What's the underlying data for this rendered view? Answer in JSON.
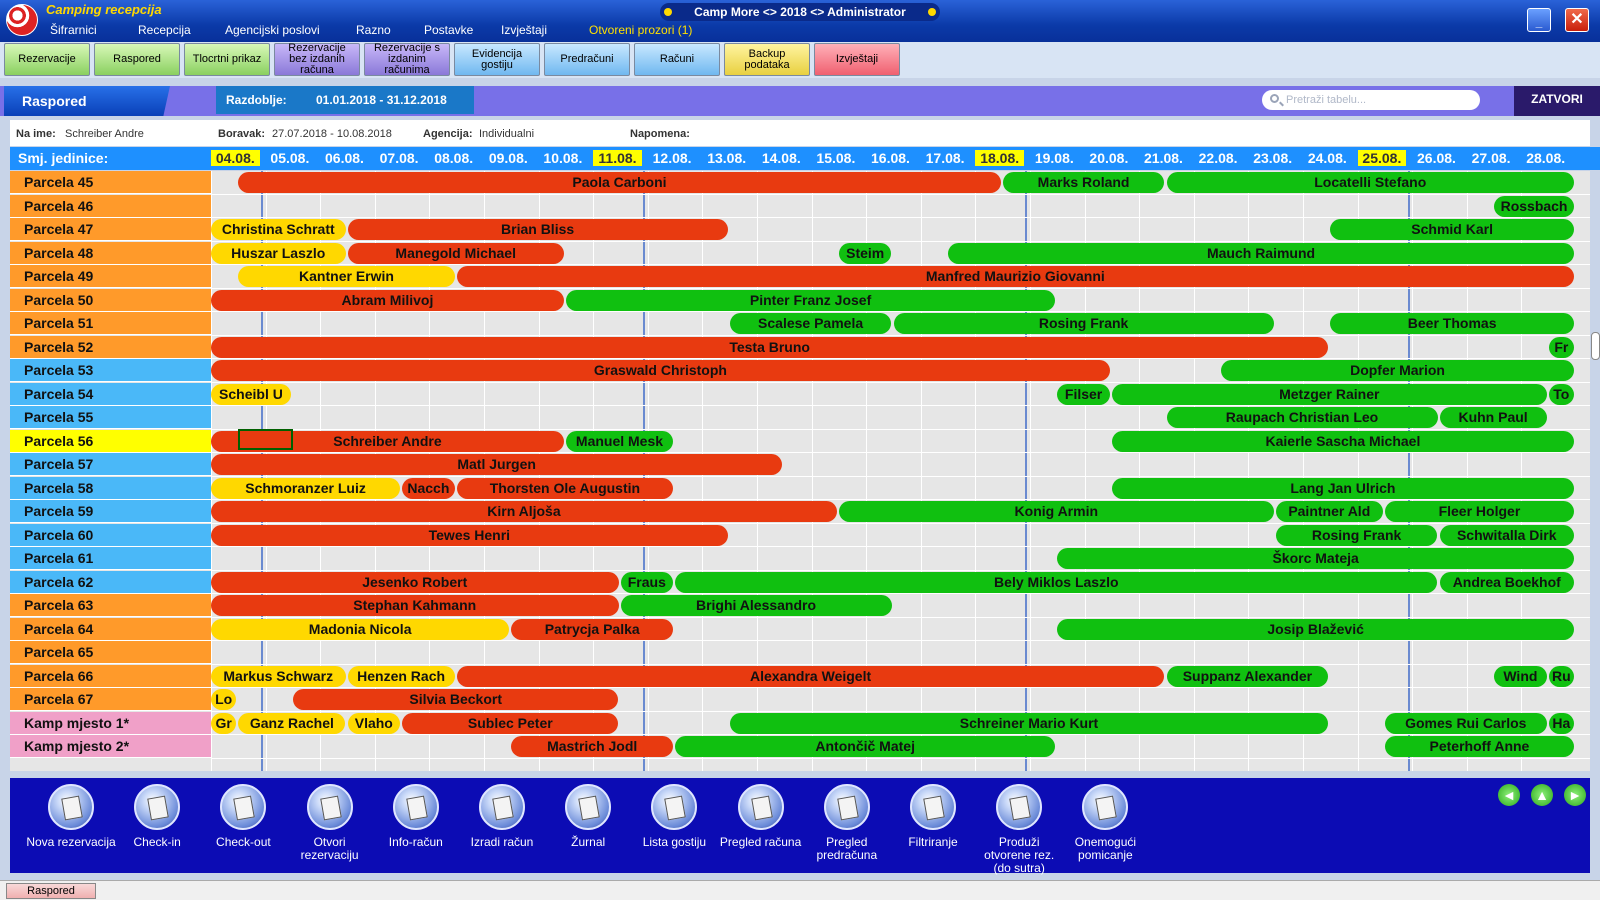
{
  "app": {
    "title": "Camping recepcija",
    "window_caption": "Camp More <> 2018 <> Administrator",
    "menu": [
      "Šifrarnici",
      "Recepcija",
      "Agencijski poslovi",
      "Razno",
      "Postavke",
      "Izvještaji",
      "Otvoreni prozori (1)"
    ],
    "minimize_label": "_",
    "close_label": "✕"
  },
  "toolbar": [
    {
      "label": "Rezervacije",
      "color": "green"
    },
    {
      "label": "Raspored",
      "color": "green"
    },
    {
      "label": "Tlocrtni prikaz",
      "color": "green"
    },
    {
      "label": "Rezervacije bez izdanih računa",
      "color": "purple"
    },
    {
      "label": "Rezervacije s izdanim računima",
      "color": "purple"
    },
    {
      "label": "Evidencija gostiju",
      "color": "blue"
    },
    {
      "label": "Predračuni",
      "color": "blue"
    },
    {
      "label": "Računi",
      "color": "blue"
    },
    {
      "label": "Backup podataka",
      "color": "yellow"
    },
    {
      "label": "Izvještaji",
      "color": "red"
    }
  ],
  "view": {
    "title": "Raspored",
    "period_label": "Razdoblje:",
    "period_value": "01.01.2018 - 31.12.2018",
    "search_placeholder": "Pretraži tabelu...",
    "close_label": "ZATVORI"
  },
  "guest_info": {
    "name_label": "Na ime:",
    "name_value": "Schreiber Andre",
    "stay_label": "Boravak:",
    "stay_value": "27.07.2018 - 10.08.2018",
    "agency_label": "Agencija:",
    "agency_value": "Individualni",
    "note_label": "Napomena:"
  },
  "schedule": {
    "units_label": "Smj. jedinice:",
    "dates": [
      "04.08.",
      "05.08.",
      "06.08.",
      "07.08.",
      "08.08.",
      "09.08.",
      "10.08.",
      "11.08.",
      "12.08.",
      "13.08.",
      "14.08.",
      "15.08.",
      "16.08.",
      "17.08.",
      "18.08.",
      "19.08.",
      "20.08.",
      "21.08.",
      "22.08.",
      "23.08.",
      "24.08.",
      "25.08.",
      "26.08.",
      "27.08.",
      "28.08."
    ],
    "highlighted_dates": [
      "04.08.",
      "11.08.",
      "18.08.",
      "25.08."
    ],
    "rows": [
      {
        "label": "Parcela 45",
        "color": "orange",
        "bars": [
          {
            "name": "Paola Carboni",
            "c": "red",
            "s": 0.5,
            "e": 14.5
          },
          {
            "name": "Marks Roland",
            "c": "green",
            "s": 14.5,
            "e": 17.5
          },
          {
            "name": "Locatelli Stefano",
            "c": "green",
            "s": 17.5,
            "e": 25
          }
        ]
      },
      {
        "label": "Parcela 46",
        "color": "orange",
        "bars": [
          {
            "name": "Rossbach",
            "c": "green",
            "s": 23.5,
            "e": 25
          }
        ]
      },
      {
        "label": "Parcela 47",
        "color": "orange",
        "bars": [
          {
            "name": "Christina Schratt",
            "c": "yellow",
            "s": 0,
            "e": 2.5
          },
          {
            "name": "Brian Bliss",
            "c": "red",
            "s": 2.5,
            "e": 9.5
          },
          {
            "name": "Schmid Karl",
            "c": "green",
            "s": 20.5,
            "e": 25
          }
        ]
      },
      {
        "label": "Parcela 48",
        "color": "orange",
        "bars": [
          {
            "name": "Huszar Laszlo",
            "c": "yellow",
            "s": 0,
            "e": 2.5
          },
          {
            "name": "Manegold Michael",
            "c": "red",
            "s": 2.5,
            "e": 6.5
          },
          {
            "name": "Steim",
            "c": "green",
            "s": 11.5,
            "e": 12.5
          },
          {
            "name": "Mauch Raimund",
            "c": "green",
            "s": 13.5,
            "e": 25
          }
        ]
      },
      {
        "label": "Parcela 49",
        "color": "orange",
        "bars": [
          {
            "name": "Kantner Erwin",
            "c": "yellow",
            "s": 0.5,
            "e": 4.5
          },
          {
            "name": "Manfred Maurizio Giovanni",
            "c": "red",
            "s": 4.5,
            "e": 25
          }
        ]
      },
      {
        "label": "Parcela 50",
        "color": "orange",
        "bars": [
          {
            "name": "Abram Milivoj",
            "c": "red",
            "s": 0,
            "e": 6.5
          },
          {
            "name": "Pinter Franz Josef",
            "c": "green",
            "s": 6.5,
            "e": 15.5
          }
        ]
      },
      {
        "label": "Parcela 51",
        "color": "orange",
        "bars": [
          {
            "name": "Scalese Pamela",
            "c": "green",
            "s": 9.5,
            "e": 12.5
          },
          {
            "name": "Rosing Frank",
            "c": "green",
            "s": 12.5,
            "e": 19.5
          },
          {
            "name": "Beer Thomas",
            "c": "green",
            "s": 20.5,
            "e": 25
          }
        ]
      },
      {
        "label": "Parcela 52",
        "color": "orange",
        "bars": [
          {
            "name": "Testa Bruno",
            "c": "red",
            "s": 0,
            "e": 20.5
          },
          {
            "name": "Fr",
            "c": "green",
            "s": 24.5,
            "e": 25
          }
        ]
      },
      {
        "label": "Parcela 53",
        "color": "blue",
        "bars": [
          {
            "name": "Graswald Christoph",
            "c": "red",
            "s": 0,
            "e": 16.5
          },
          {
            "name": "Dopfer Marion",
            "c": "green",
            "s": 18.5,
            "e": 25
          }
        ]
      },
      {
        "label": "Parcela 54",
        "color": "blue",
        "bars": [
          {
            "name": "Scheibl U",
            "c": "yellow",
            "s": 0,
            "e": 1.5
          },
          {
            "name": "Filser",
            "c": "green",
            "s": 15.5,
            "e": 16.5
          },
          {
            "name": "Metzger Rainer",
            "c": "green",
            "s": 16.5,
            "e": 24.5
          },
          {
            "name": "To",
            "c": "green",
            "s": 24.5,
            "e": 25
          }
        ]
      },
      {
        "label": "Parcela 55",
        "color": "blue",
        "bars": [
          {
            "name": "Raupach Christian Leo",
            "c": "green",
            "s": 17.5,
            "e": 22.5
          },
          {
            "name": "Kuhn Paul",
            "c": "green",
            "s": 22.5,
            "e": 24.5
          }
        ]
      },
      {
        "label": "Parcela 56",
        "color": "yellow",
        "bars": [
          {
            "name": "Schreiber Andre",
            "c": "red",
            "s": 0,
            "e": 6.5
          },
          {
            "name": "Manuel Mesk",
            "c": "green",
            "s": 6.5,
            "e": 8.5
          },
          {
            "name": "Kaierle Sascha Michael",
            "c": "green",
            "s": 16.5,
            "e": 25
          }
        ]
      },
      {
        "label": "Parcela 57",
        "color": "blue",
        "bars": [
          {
            "name": "Matl Jurgen",
            "c": "red",
            "s": 0,
            "e": 10.5
          }
        ]
      },
      {
        "label": "Parcela 58",
        "color": "blue",
        "bars": [
          {
            "name": "Schmoranzer Luiz",
            "c": "yellow",
            "s": 0,
            "e": 3.5
          },
          {
            "name": "Nacch",
            "c": "red",
            "s": 3.5,
            "e": 4.5
          },
          {
            "name": "Thorsten Ole Augustin",
            "c": "red",
            "s": 4.5,
            "e": 8.5
          },
          {
            "name": "Lang Jan Ulrich",
            "c": "green",
            "s": 16.5,
            "e": 25
          }
        ]
      },
      {
        "label": "Parcela 59",
        "color": "blue",
        "bars": [
          {
            "name": "Kirn Aljoša",
            "c": "red",
            "s": 0,
            "e": 11.5
          },
          {
            "name": "Konig Armin",
            "c": "green",
            "s": 11.5,
            "e": 19.5
          },
          {
            "name": "Paintner Ald",
            "c": "green",
            "s": 19.5,
            "e": 21.5
          },
          {
            "name": "Fleer Holger",
            "c": "green",
            "s": 21.5,
            "e": 25
          }
        ]
      },
      {
        "label": "Parcela 60",
        "color": "blue",
        "bars": [
          {
            "name": "Tewes Henri",
            "c": "red",
            "s": 0,
            "e": 9.5
          },
          {
            "name": "Rosing Frank",
            "c": "green",
            "s": 19.5,
            "e": 22.5
          },
          {
            "name": "Schwitalla Dirk",
            "c": "green",
            "s": 22.5,
            "e": 25
          }
        ]
      },
      {
        "label": "Parcela 61",
        "color": "blue",
        "bars": [
          {
            "name": "Škorc Mateja",
            "c": "green",
            "s": 15.5,
            "e": 25
          }
        ]
      },
      {
        "label": "Parcela 62",
        "color": "blue",
        "bars": [
          {
            "name": "Jesenko Robert",
            "c": "red",
            "s": 0,
            "e": 7.5
          },
          {
            "name": "Fraus",
            "c": "green",
            "s": 7.5,
            "e": 8.5
          },
          {
            "name": "Bely Miklos Laszlo",
            "c": "green",
            "s": 8.5,
            "e": 22.5
          },
          {
            "name": "Andrea Boekhof",
            "c": "green",
            "s": 22.5,
            "e": 25
          }
        ]
      },
      {
        "label": "Parcela 63",
        "color": "orange",
        "bars": [
          {
            "name": "Stephan Kahmann",
            "c": "red",
            "s": 0,
            "e": 7.5
          },
          {
            "name": "Brighi Alessandro",
            "c": "green",
            "s": 7.5,
            "e": 12.5
          }
        ]
      },
      {
        "label": "Parcela 64",
        "color": "orange",
        "bars": [
          {
            "name": "Madonia Nicola",
            "c": "yellow",
            "s": 0,
            "e": 5.5
          },
          {
            "name": "Patrycja Palka",
            "c": "red",
            "s": 5.5,
            "e": 8.5
          },
          {
            "name": "Josip Blažević",
            "c": "green",
            "s": 15.5,
            "e": 25
          }
        ]
      },
      {
        "label": "Parcela 65",
        "color": "orange",
        "bars": []
      },
      {
        "label": "Parcela 66",
        "color": "orange",
        "bars": [
          {
            "name": "Markus Schwarz",
            "c": "yellow",
            "s": 0,
            "e": 2.5
          },
          {
            "name": "Henzen Rach",
            "c": "yellow",
            "s": 2.5,
            "e": 4.5
          },
          {
            "name": "Alexandra Weigelt",
            "c": "red",
            "s": 4.5,
            "e": 17.5
          },
          {
            "name": "Suppanz Alexander",
            "c": "green",
            "s": 17.5,
            "e": 20.5
          },
          {
            "name": "Wind",
            "c": "green",
            "s": 23.5,
            "e": 24.5
          },
          {
            "name": "Ru",
            "c": "green",
            "s": 24.5,
            "e": 25
          }
        ]
      },
      {
        "label": "Parcela 67",
        "color": "orange",
        "bars": [
          {
            "name": "Lo",
            "c": "yellow",
            "s": 0,
            "e": 0.5
          },
          {
            "name": "Silvia Beckort",
            "c": "red",
            "s": 1.5,
            "e": 7.5
          }
        ]
      },
      {
        "label": "Kamp mjesto 1*",
        "color": "pink",
        "bars": [
          {
            "name": "Gr",
            "c": "yellow",
            "s": 0,
            "e": 0.5
          },
          {
            "name": "Ganz Rachel",
            "c": "yellow",
            "s": 0.5,
            "e": 2.5
          },
          {
            "name": "Vlaho",
            "c": "yellow",
            "s": 2.5,
            "e": 3.5
          },
          {
            "name": "Sublec Peter",
            "c": "red",
            "s": 3.5,
            "e": 7.5
          },
          {
            "name": "Schreiner Mario Kurt",
            "c": "green",
            "s": 9.5,
            "e": 20.5
          },
          {
            "name": "Gomes Rui Carlos",
            "c": "green",
            "s": 21.5,
            "e": 24.5
          },
          {
            "name": "Ha",
            "c": "green",
            "s": 24.5,
            "e": 25
          }
        ]
      },
      {
        "label": "Kamp mjesto 2*",
        "color": "pink",
        "bars": [
          {
            "name": "Mastrich Jodl",
            "c": "red",
            "s": 5.5,
            "e": 8.5
          },
          {
            "name": "Antončič Matej",
            "c": "green",
            "s": 8.5,
            "e": 15.5
          },
          {
            "name": "Peterhoff Anne",
            "c": "green",
            "s": 21.5,
            "e": 25
          }
        ]
      }
    ]
  },
  "bottom_actions": [
    {
      "label": "Nova rezervacija",
      "icon": "new-reservation-icon"
    },
    {
      "label": "Check-in",
      "icon": "check-in-icon"
    },
    {
      "label": "Check-out",
      "icon": "check-out-icon"
    },
    {
      "label": "Otvori rezervaciju",
      "icon": "open-reservation-icon"
    },
    {
      "label": "Info-račun",
      "icon": "info-invoice-icon"
    },
    {
      "label": "Izradi račun",
      "icon": "create-invoice-icon"
    },
    {
      "label": "Žurnal",
      "icon": "journal-icon"
    },
    {
      "label": "Lista gostiju",
      "icon": "guest-list-icon"
    },
    {
      "label": "Pregled računa",
      "icon": "invoice-review-icon"
    },
    {
      "label": "Pregled predračuna",
      "icon": "proforma-review-icon"
    },
    {
      "label": "Filtriranje",
      "icon": "filter-icon"
    },
    {
      "label": "Produži otvorene rez. (do sutra)",
      "icon": "extend-reservations-icon"
    },
    {
      "label": "Onemogući pomicanje",
      "icon": "disable-moving-icon"
    }
  ],
  "nav_arrows": [
    "arrow-left-icon",
    "arrow-up-icon",
    "arrow-right-icon"
  ],
  "status_bar": {
    "tab_label": "Raspored"
  }
}
